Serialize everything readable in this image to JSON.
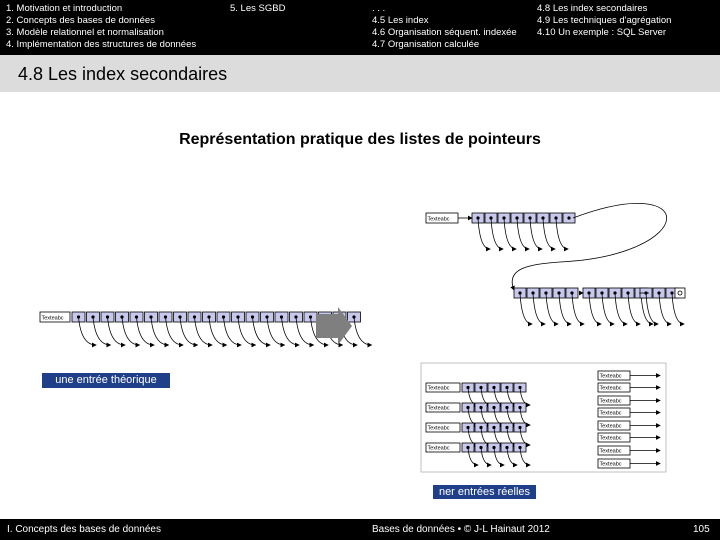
{
  "header": {
    "col1": [
      "1. Motivation et introduction",
      "2. Concepts des bases de données",
      "3. Modèle relationnel et normalisation",
      "4. Implémentation des structures de données"
    ],
    "col2": "5. Les SGBD",
    "col3": [
      ". . .",
      "4.5 Les index",
      "4.6 Organisation séquent. indexée",
      "4.7 Organisation calculée"
    ],
    "col4": [
      "4.8 Les index secondaires",
      "4.9 Les techniques d'agrégation",
      "4.10 Un exemple : SQL Server"
    ]
  },
  "section_title": "4.8 Les index secondaires",
  "subtitle": "Représentation pratique des listes de pointeurs",
  "diagram": {
    "key_label": "Texteabc",
    "callout_left": "une entrée théorique",
    "callout_bottom": "n",
    "callout_bottom_rest": "er entrées réelles",
    "arrow_color": "#7f7f7f",
    "node_fill": "#c8c8ec",
    "callout_color": "#1f3f88"
  },
  "footer": {
    "left": "I. Concepts des bases de données",
    "center": "Bases de données • © J-L Hainaut 2012",
    "page": "105"
  }
}
